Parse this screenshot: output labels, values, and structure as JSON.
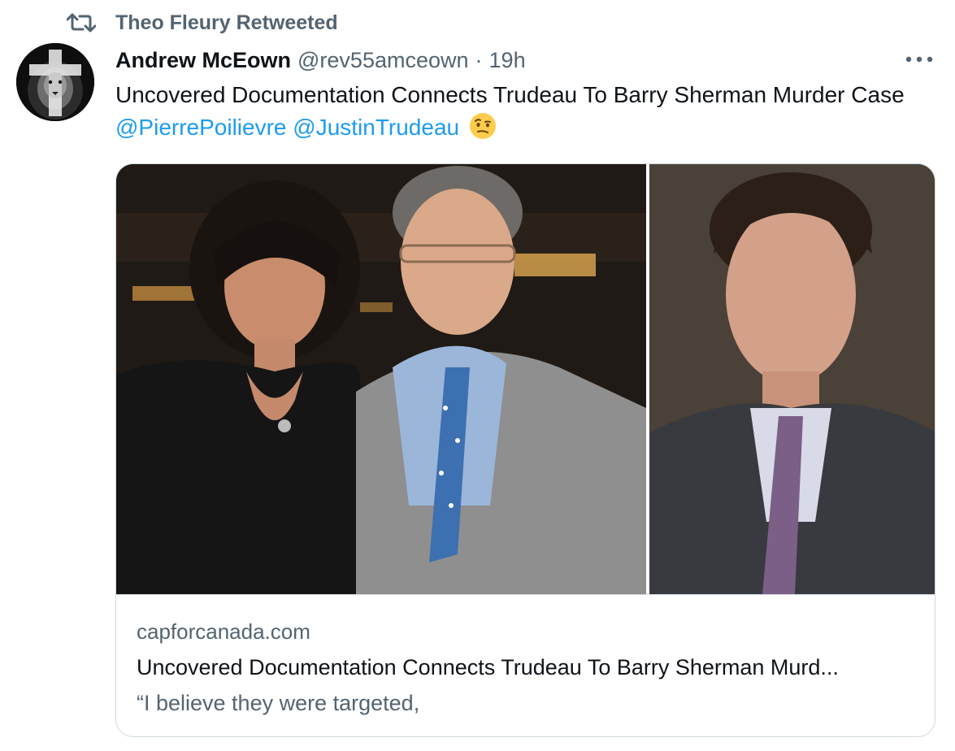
{
  "retweet": {
    "label": "Theo Fleury Retweeted",
    "icon": "retweet-icon"
  },
  "author": {
    "name": "Andrew McEown",
    "handle": "@rev55amceown",
    "separator": "·",
    "time": "19h",
    "avatar": "lion-cross-avatar"
  },
  "tweet": {
    "text_prefix": "Uncovered Documentation Connects Trudeau To Barry Sherman Murder Case",
    "mentions": [
      "@PierrePoilievre",
      "@JustinTrudeau"
    ],
    "emoji": "face-with-raised-eyebrow"
  },
  "card": {
    "domain": "capforcanada.com",
    "title": "Uncovered Documentation Connects Trudeau To Barry Sherman Murd...",
    "description": "“I believe they were targeted,"
  },
  "colors": {
    "text": "#0f1419",
    "secondary": "#536471",
    "link": "#1d9bf0",
    "border": "#cfd9de"
  }
}
